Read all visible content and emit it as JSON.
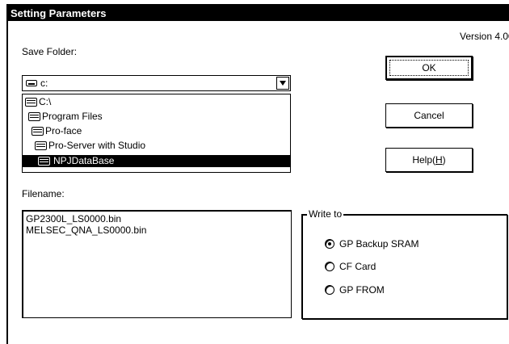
{
  "window": {
    "title": "Setting Parameters",
    "version": "Version 4.00"
  },
  "save_folder": {
    "label": "Save Folder:",
    "drive_value": "c:",
    "folders": [
      {
        "label": "C:\\",
        "selected": false
      },
      {
        "label": "Program Files",
        "selected": false
      },
      {
        "label": "Pro-face",
        "selected": false
      },
      {
        "label": "Pro-Server with Studio",
        "selected": false
      },
      {
        "label": "NPJDataBase",
        "selected": true
      }
    ]
  },
  "filename": {
    "label": "Filename:",
    "files": [
      "GP2300L_LS0000.bin",
      "MELSEC_QNA_LS0000.bin"
    ]
  },
  "buttons": {
    "ok": "OK",
    "cancel": "Cancel",
    "help_prefix": "Help(",
    "help_key": "H",
    "help_suffix": ")"
  },
  "write_to": {
    "title": "Write to",
    "options": [
      {
        "label": "GP Backup SRAM",
        "checked": true
      },
      {
        "label": "CF Card",
        "checked": false
      },
      {
        "label": "GP FROM",
        "checked": false
      }
    ]
  },
  "icons": {
    "drive": "drive-icon",
    "folder": "folder-icon",
    "dropdown": "chevron-down-icon"
  },
  "colors": {
    "titlebar_bg": "#000000",
    "selection_bg": "#000000",
    "dialog_bg": "#ffffff"
  }
}
